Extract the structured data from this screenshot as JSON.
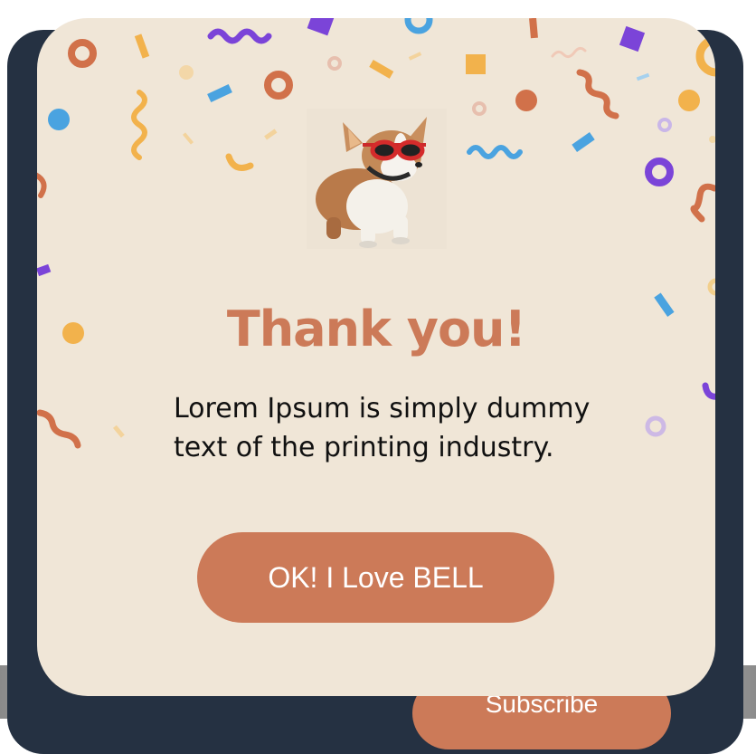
{
  "modal": {
    "title": "Thank you!",
    "message": "Lorem Ipsum is simply dummy text of the printing industry.",
    "ok_button_label": "OK! I Love BELL",
    "image": "corgi-with-goggles"
  },
  "background": {
    "subscribe_label": "Subscribe"
  },
  "colors": {
    "accent": "#cc7a58",
    "modal_bg": "#f0e6d7",
    "dark_panel": "#253142",
    "confetti_orange": "#f2b24c",
    "confetti_rust": "#d1714a",
    "confetti_purple": "#7b44d8",
    "confetti_blue": "#4aa3e0"
  }
}
